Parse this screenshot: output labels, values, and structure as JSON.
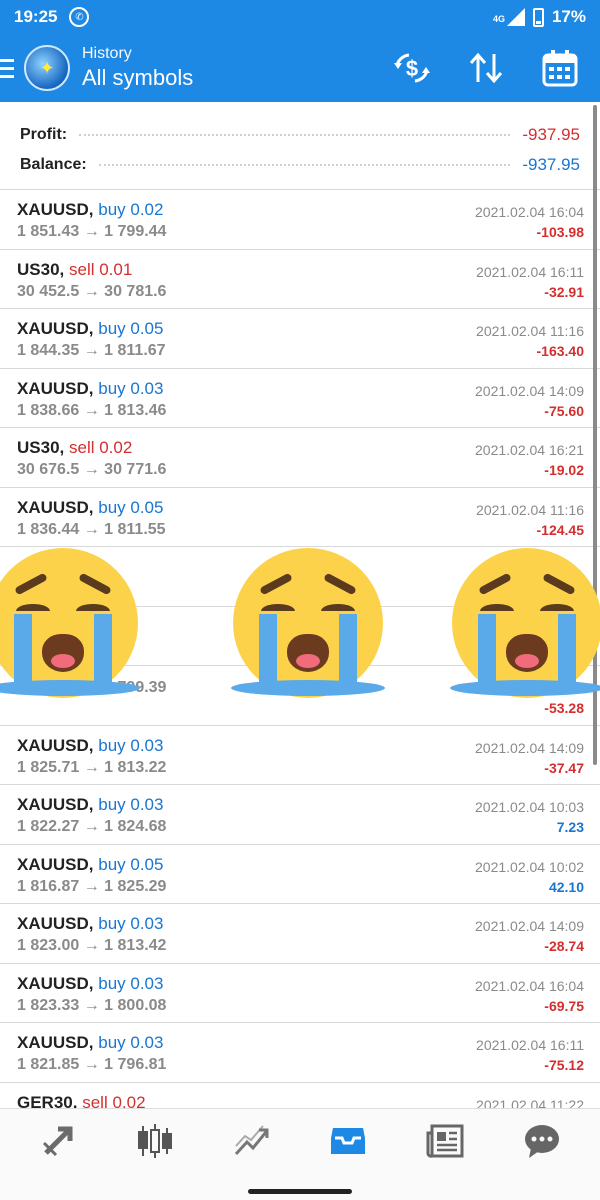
{
  "status_bar": {
    "time": "19:25",
    "network": "4G",
    "battery": "17%"
  },
  "header": {
    "subtitle": "History",
    "title": "All symbols"
  },
  "summary": {
    "profit_label": "Profit:",
    "profit_value": "-937.95",
    "balance_label": "Balance:",
    "balance_value": "-937.95"
  },
  "colors": {
    "header": "#1e88e5",
    "sell": "#d32f2f",
    "buy": "#1976d2",
    "loss": "#d32f2f",
    "gain": "#1976d2"
  },
  "trades": [
    {
      "symbol": "XAUUSD,",
      "side": "buy 0.02",
      "prices": "1 851.43 → 1 799.44",
      "time": "2021.02.04 16:04",
      "pl": "-103.98"
    },
    {
      "symbol": "US30,",
      "side": "sell 0.01",
      "prices": "30 452.5 → 30 781.6",
      "time": "2021.02.04 16:11",
      "pl": "-32.91"
    },
    {
      "symbol": "XAUUSD,",
      "side": "buy 0.05",
      "prices": "1 844.35 → 1 811.67",
      "time": "2021.02.04 11:16",
      "pl": "-163.40"
    },
    {
      "symbol": "XAUUSD,",
      "side": "buy 0.03",
      "prices": "1 838.66 → 1 813.46",
      "time": "2021.02.04 14:09",
      "pl": "-75.60"
    },
    {
      "symbol": "US30,",
      "side": "sell 0.02",
      "prices": "30 676.5 → 30 771.6",
      "time": "2021.02.04 16:21",
      "pl": "-19.02"
    },
    {
      "symbol": "XAUUSD,",
      "side": "buy 0.05",
      "prices": "1 836.44 → 1 811.55",
      "time": "2021.02.04 11:16",
      "pl": "-124.45"
    },
    {
      "symbol": "",
      "side": "",
      "prices": "",
      "time": "",
      "pl": ""
    },
    {
      "symbol": "",
      "side": "",
      "prices": "",
      "time": "",
      "pl": ""
    },
    {
      "symbol": "",
      "side": "",
      "prices": "1 826.03 → 1 799.39",
      "time": "",
      "pl": "-53.28"
    },
    {
      "symbol": "XAUUSD,",
      "side": "buy 0.03",
      "prices": "1 825.71 → 1 813.22",
      "time": "2021.02.04 14:09",
      "pl": "-37.47"
    },
    {
      "symbol": "XAUUSD,",
      "side": "buy 0.03",
      "prices": "1 822.27 → 1 824.68",
      "time": "2021.02.04 10:03",
      "pl": "7.23"
    },
    {
      "symbol": "XAUUSD,",
      "side": "buy 0.05",
      "prices": "1 816.87 → 1 825.29",
      "time": "2021.02.04 10:02",
      "pl": "42.10"
    },
    {
      "symbol": "XAUUSD,",
      "side": "buy 0.03",
      "prices": "1 823.00 → 1 813.42",
      "time": "2021.02.04 14:09",
      "pl": "-28.74"
    },
    {
      "symbol": "XAUUSD,",
      "side": "buy 0.03",
      "prices": "1 823.33 → 1 800.08",
      "time": "2021.02.04 16:04",
      "pl": "-69.75"
    },
    {
      "symbol": "XAUUSD,",
      "side": "buy 0.03",
      "prices": "1 821.85 → 1 796.81",
      "time": "2021.02.04 16:11",
      "pl": "-75.12"
    },
    {
      "symbol": "GER30,",
      "side": "sell 0.02",
      "prices": "",
      "time": "2021.02.04 11:22",
      "pl": ""
    }
  ],
  "nav": [
    "trade-icon",
    "quotes-icon",
    "chart-icon",
    "history-icon",
    "news-icon",
    "chat-icon"
  ]
}
